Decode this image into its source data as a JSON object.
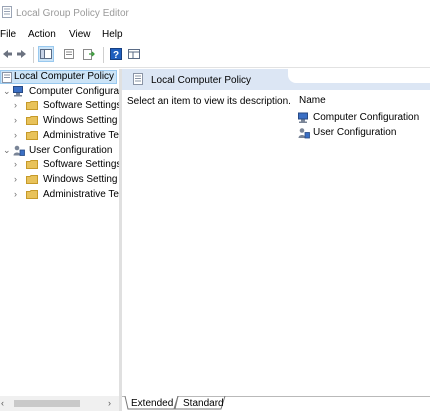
{
  "window": {
    "title": "Local Group Policy Editor"
  },
  "menu": {
    "items": [
      "File",
      "Action",
      "View",
      "Help"
    ]
  },
  "toolbar": {
    "buttons": [
      "back-arrow-icon",
      "forward-arrow-icon",
      "show-hide-tree-icon",
      "properties-icon",
      "export-list-icon",
      "help-icon",
      "extended-view-icon"
    ]
  },
  "tree": {
    "root": "Local Computer Policy",
    "computer": {
      "label": "Computer Configura",
      "children": [
        "Software Settings",
        "Windows Setting",
        "Administrative Te"
      ]
    },
    "user": {
      "label": "User Configuration",
      "children": [
        "Software Settings",
        "Windows Setting",
        "Administrative Te"
      ]
    }
  },
  "main": {
    "header_title": "Local Computer Policy",
    "description": "Select an item to view its description.",
    "column_name": "Name",
    "items": [
      "Computer Configuration",
      "User Configuration"
    ]
  },
  "tabs": {
    "extended": "Extended",
    "standard": "Standard"
  },
  "colors": {
    "header_bg": "#dce6f4",
    "folder": "#e8c25a",
    "selection": "#cce4f7"
  }
}
